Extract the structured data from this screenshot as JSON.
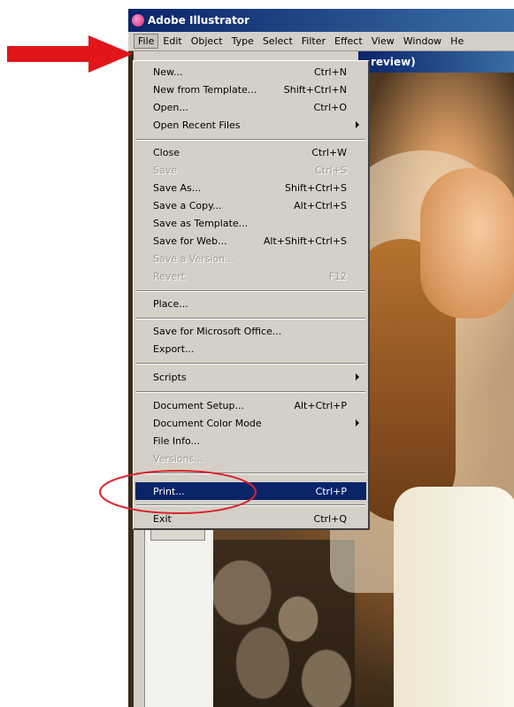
{
  "app": {
    "title": "Adobe Illustrator"
  },
  "menubar": {
    "items": [
      "File",
      "Edit",
      "Object",
      "Type",
      "Select",
      "Filter",
      "Effect",
      "View",
      "Window",
      "He"
    ],
    "active": "File"
  },
  "document": {
    "title_fragment": "review)"
  },
  "file_menu": {
    "items": [
      {
        "label": "New...",
        "shortcut": "Ctrl+N"
      },
      {
        "label": "New from Template...",
        "shortcut": "Shift+Ctrl+N"
      },
      {
        "label": "Open...",
        "shortcut": "Ctrl+O"
      },
      {
        "label": "Open Recent Files",
        "shortcut": ""
      },
      {
        "label": "Close",
        "shortcut": "Ctrl+W"
      },
      {
        "label": "Save",
        "shortcut": "Ctrl+S"
      },
      {
        "label": "Save As...",
        "shortcut": "Shift+Ctrl+S"
      },
      {
        "label": "Save a Copy...",
        "shortcut": "Alt+Ctrl+S"
      },
      {
        "label": "Save as Template...",
        "shortcut": ""
      },
      {
        "label": "Save for Web...",
        "shortcut": "Alt+Shift+Ctrl+S"
      },
      {
        "label": "Save a Version...",
        "shortcut": ""
      },
      {
        "label": "Revert",
        "shortcut": "F12"
      },
      {
        "label": "Place...",
        "shortcut": ""
      },
      {
        "label": "Save for Microsoft Office...",
        "shortcut": ""
      },
      {
        "label": "Export...",
        "shortcut": ""
      },
      {
        "label": "Scripts",
        "shortcut": ""
      },
      {
        "label": "Document Setup...",
        "shortcut": "Alt+Ctrl+P"
      },
      {
        "label": "Document Color Mode",
        "shortcut": ""
      },
      {
        "label": "File Info...",
        "shortcut": ""
      },
      {
        "label": "Versions...",
        "shortcut": ""
      },
      {
        "label": "Print...",
        "shortcut": "Ctrl+P"
      },
      {
        "label": "Exit",
        "shortcut": "Ctrl+Q"
      }
    ],
    "highlighted": "Print...",
    "disabled": [
      "Save",
      "Save a Version...",
      "Revert",
      "Versions..."
    ],
    "submenus": [
      "Open Recent Files",
      "Scripts",
      "Document Color Mode"
    ]
  },
  "annotations": {
    "pointer_arrow_color": "#e0161b",
    "circle_color": "#d8232a"
  },
  "colors": {
    "titlebar": "#0a246a",
    "menu_bg": "#d4d0c8",
    "highlight": "#0a246a"
  }
}
